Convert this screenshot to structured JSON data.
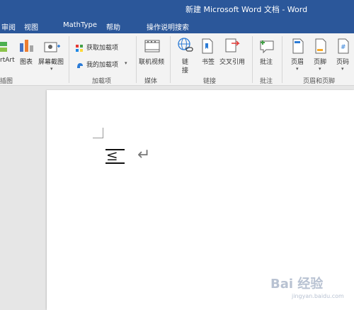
{
  "window": {
    "title": "新建 Microsoft Word 文档 - Word"
  },
  "menu": {
    "review": "审阅",
    "view": "视图",
    "mathtype": "MathType",
    "help": "帮助",
    "tell_me": "操作说明搜索"
  },
  "ribbon": {
    "smartart": "rtArt",
    "chart": "图表",
    "screenshot": "屏幕截图",
    "illustrations_group": "插图",
    "get_addins": "获取加载项",
    "my_addins": "我的加载项",
    "addins_group": "加载项",
    "online_video": "联机视频",
    "media_group": "媒体",
    "link_line1": "链",
    "link_line2": "接",
    "bookmark": "书签",
    "cross_ref": "交叉引用",
    "links_group": "链接",
    "comment": "批注",
    "comments_group": "批注",
    "header": "页眉",
    "footer": "页脚",
    "page_number": "页码",
    "header_footer_group": "页眉和页脚"
  },
  "document": {
    "equation_text": "≤",
    "paragraph_mark": "↵"
  },
  "watermark": {
    "text": "Bai 经验",
    "sub": "jingyan.baidu.com"
  },
  "colors": {
    "accent": "#2b579a",
    "ribbon_bg": "#f3f3f3",
    "canvas_bg": "#e6e6e6"
  }
}
